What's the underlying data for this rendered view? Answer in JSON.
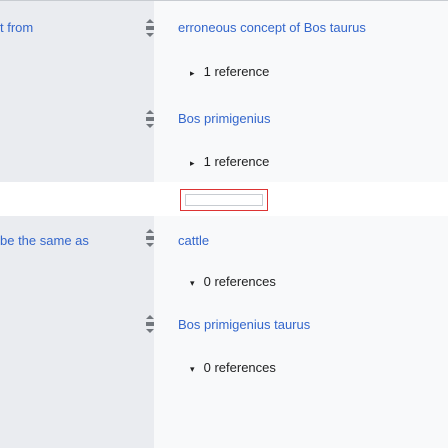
{
  "statement_1": {
    "property_label": "t from",
    "values": [
      {
        "text": "erroneous concept of Bos taurus",
        "references": "1 reference",
        "ref_arrow": "▸"
      },
      {
        "text": "Bos primigenius",
        "references": "1 reference",
        "ref_arrow": "▸"
      }
    ]
  },
  "statement_2": {
    "property_label": "be the same as",
    "values": [
      {
        "text": "cattle",
        "references": "0 references",
        "ref_arrow": "▾"
      },
      {
        "text": "Bos primigenius taurus",
        "references": "0 references",
        "ref_arrow": "▾"
      }
    ]
  },
  "colors": {
    "link": "#3366cc",
    "label_bg": "#eaecf0",
    "value_bg": "#f8f9fa",
    "focus_border": "#dd3333"
  }
}
